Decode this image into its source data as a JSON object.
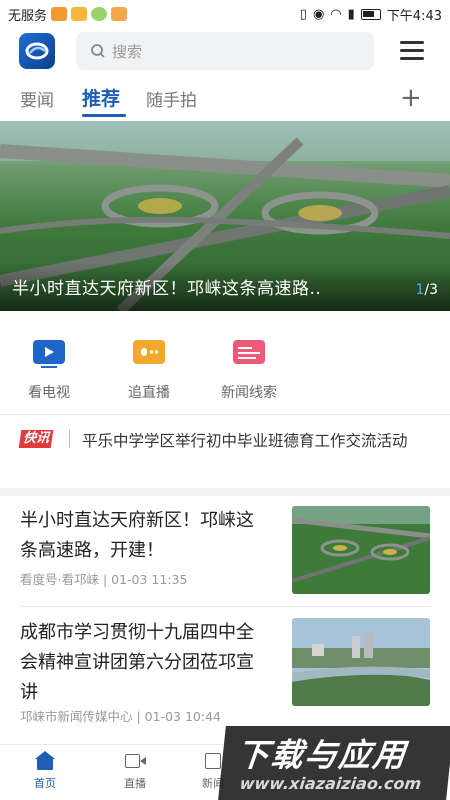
{
  "status_bar": {
    "carrier": "无服务",
    "time": "下午4:43"
  },
  "header": {
    "search_placeholder": "搜索"
  },
  "tabs": [
    {
      "label": "要闻"
    },
    {
      "label": "推荐"
    },
    {
      "label": "随手拍"
    }
  ],
  "active_tab": "推荐",
  "banner": {
    "title": "半小时直达天府新区！邛崃这条高速路..",
    "page_current": "1",
    "page_total": "/3"
  },
  "shortcuts": [
    {
      "label": "看电视",
      "icon": "tv-icon",
      "color": "#1f66c8"
    },
    {
      "label": "追直播",
      "icon": "live-icon",
      "color": "#f1a72a"
    },
    {
      "label": "新闻线索",
      "icon": "news-lead-icon",
      "color": "#ec5a7a"
    }
  ],
  "flash": {
    "tag": "快讯",
    "text": "平乐中学学区举行初中毕业班德育工作交流活动"
  },
  "news": [
    {
      "title": "半小时直达天府新区！邛崃这条高速路，开建！",
      "meta": "看度号·看邛崃 | 01-03 11:35"
    },
    {
      "title": "成都市学习贯彻十九届四中全会精神宣讲团第六分团莅邛宣讲",
      "meta": "邛崃市新闻传媒中心 | 01-03 10:44"
    }
  ],
  "bottom_nav": [
    {
      "label": "首页",
      "icon": "home-icon"
    },
    {
      "label": "直播",
      "icon": "video-icon"
    },
    {
      "label": "新闻",
      "icon": "news-icon"
    }
  ],
  "watermark": {
    "main": "下载与应用",
    "sub": "www.xiazaiziao.com"
  },
  "colors": {
    "accent": "#1e5fb3",
    "flash_red": "#e23b3b"
  }
}
